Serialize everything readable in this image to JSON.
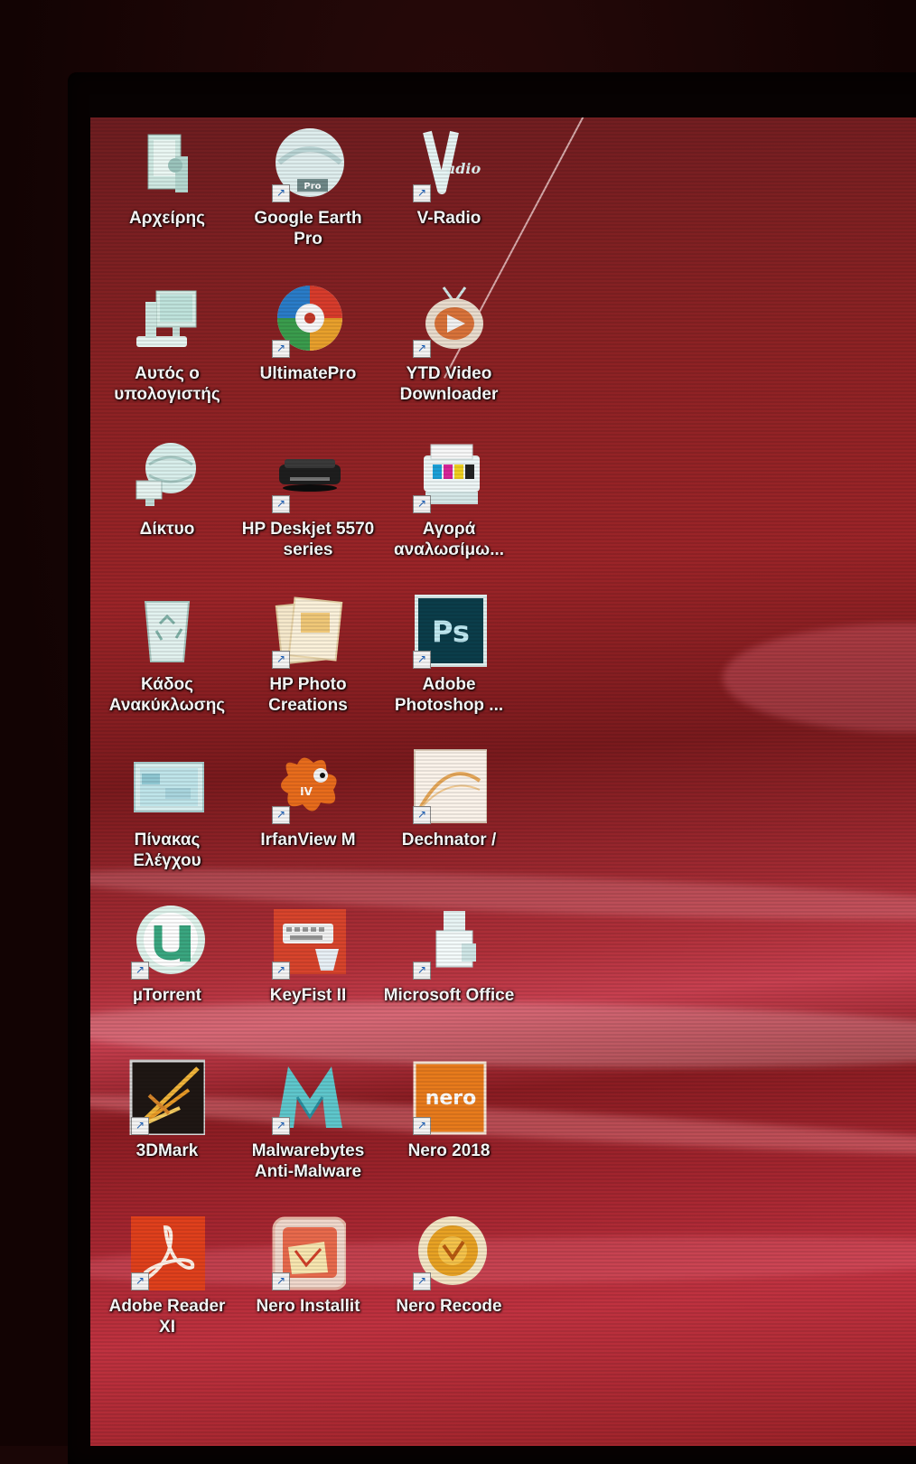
{
  "desktop": {
    "icons": [
      {
        "label": "Αρχείρης",
        "icon": "user-folder-icon",
        "shortcut": false
      },
      {
        "label": "Google Earth Pro",
        "icon": "google-earth-icon",
        "shortcut": true
      },
      {
        "label": "V-Radio",
        "icon": "v-radio-icon",
        "shortcut": true
      },
      {
        "label": "Αυτός ο υπολογιστής",
        "icon": "computer-icon",
        "shortcut": false
      },
      {
        "label": "UltimatePro",
        "icon": "lifebuoy-icon",
        "shortcut": true
      },
      {
        "label": "YTD Video Downloader",
        "icon": "ytd-downloader-icon",
        "shortcut": true
      },
      {
        "label": "Δίκτυο",
        "icon": "network-globe-icon",
        "shortcut": false
      },
      {
        "label": "HP Deskjet 5570 series",
        "icon": "printer-icon",
        "shortcut": true
      },
      {
        "label": "Αγορά αναλωσίμω...",
        "icon": "printer-supplies-icon",
        "shortcut": true
      },
      {
        "label": "Κάδος Ανακύκλωσης",
        "icon": "recycle-bin-icon",
        "shortcut": false
      },
      {
        "label": "HP Photo Creations",
        "icon": "photo-creations-icon",
        "shortcut": true
      },
      {
        "label": "Adobe Photoshop ...",
        "icon": "photoshop-icon",
        "shortcut": true,
        "badge": "Ps"
      },
      {
        "label": "Πίνακας Ελέγχου",
        "icon": "control-panel-icon",
        "shortcut": false
      },
      {
        "label": "IrfanView M",
        "icon": "irfanview-icon",
        "shortcut": true
      },
      {
        "label": "Dechnator /",
        "icon": "document-icon",
        "shortcut": true
      },
      {
        "label": "µTorrent",
        "icon": "utorrent-icon",
        "shortcut": true
      },
      {
        "label": "KeyFist II",
        "icon": "keyboard-icon",
        "shortcut": true
      },
      {
        "label": "Microsoft Office",
        "icon": "office-folder-icon",
        "shortcut": true
      },
      {
        "label": "3DMark",
        "icon": "3dmark-icon",
        "shortcut": true
      },
      {
        "label": "Malwarebytes Anti-Malware",
        "icon": "malwarebytes-icon",
        "shortcut": true
      },
      {
        "label": "Nero 2018",
        "icon": "nero-icon",
        "shortcut": true,
        "badge": "nero"
      },
      {
        "label": "Adobe Reader XI",
        "icon": "adobe-reader-icon",
        "shortcut": true
      },
      {
        "label": "Nero Installit",
        "icon": "nero-install-icon",
        "shortcut": true
      },
      {
        "label": "Nero Recode",
        "icon": "nero-recode-icon",
        "shortcut": true
      }
    ]
  },
  "colors": {
    "wallpaper": "#9b2428",
    "label_text": "#ffffff",
    "photoshop": "#0b3d4a",
    "nero": "#e87b1c",
    "adobe_reader": "#e0401c"
  }
}
